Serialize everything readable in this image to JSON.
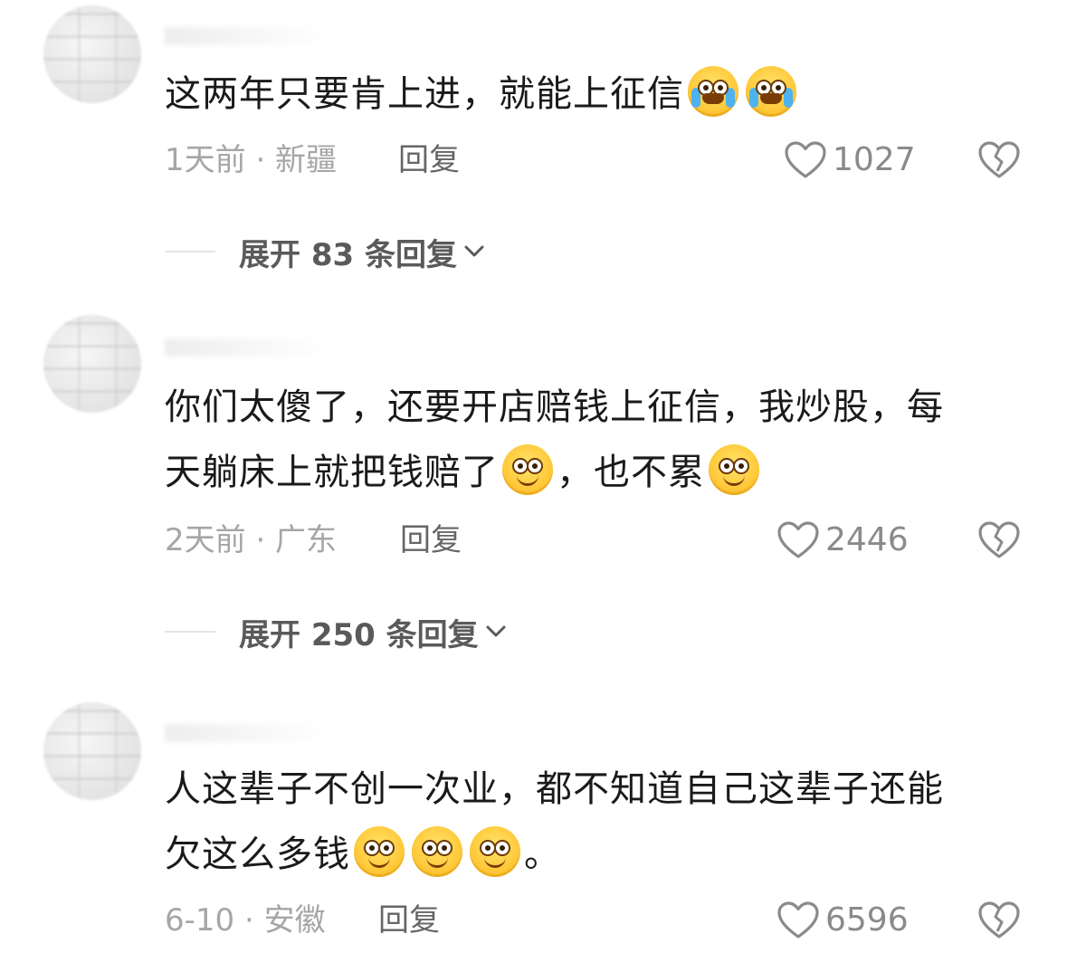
{
  "comments": [
    {
      "text": "这两年只要肯上进，就能上征信",
      "time_location": "1天前 · 新疆",
      "reply_label": "回复",
      "likes": "1027",
      "expand_label": "展开 83 条回复",
      "emoji": "crying-laughing"
    },
    {
      "text_line1": "你们太傻了，还要开店赔钱上征信，我炒股，每",
      "text_line2a": "天躺床上就把钱赔了",
      "text_line2b": "，也不累",
      "time_location": "2天前 · 广东",
      "reply_label": "回复",
      "likes": "2446",
      "expand_label": "展开 250 条回复",
      "emoji": "smile"
    },
    {
      "text_line1": "人这辈子不创一次业，都不知道自己这辈子还能",
      "text_line2": "欠这么多钱",
      "text_end": "。",
      "time_location": "6-10 · 安徽",
      "reply_label": "回复",
      "likes": "6596",
      "emoji": "smile"
    }
  ],
  "colors": {
    "meta": "#a6a6a6",
    "reply": "#666666",
    "icon": "#8a8a8a"
  }
}
